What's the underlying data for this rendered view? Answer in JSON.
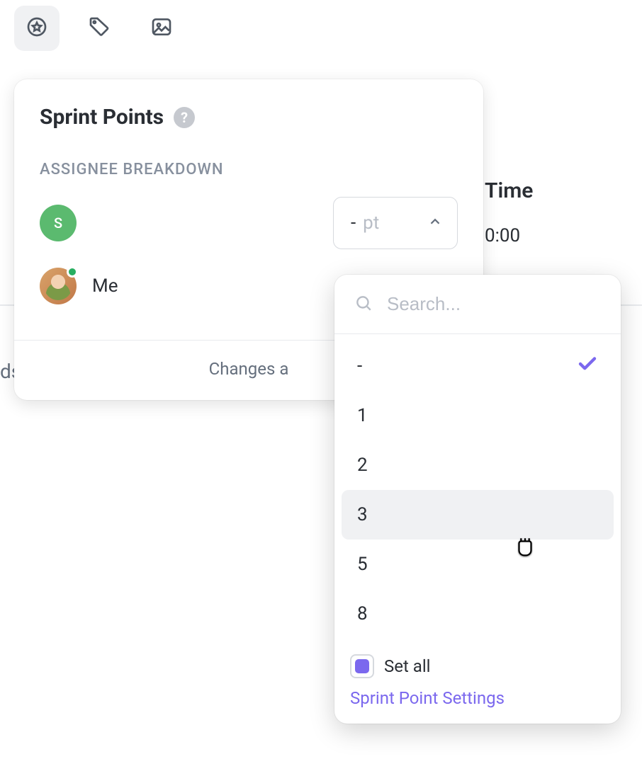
{
  "toolbar": {
    "icons": [
      "star-badge-icon",
      "tag-icon",
      "image-icon"
    ]
  },
  "background": {
    "time_label": "Time",
    "time_value": "0:00",
    "truncated_left": "ds"
  },
  "popover": {
    "title": "Sprint Points",
    "section_label": "ASSIGNEE BREAKDOWN",
    "assignees": [
      {
        "initial": "S",
        "name": "",
        "blurred": true
      },
      {
        "initial": "",
        "name": "Me",
        "photo": true,
        "presence": true
      }
    ],
    "points_select": {
      "value": "-",
      "unit": "pt"
    },
    "footer_text": "Changes a"
  },
  "dropdown": {
    "search_placeholder": "Search...",
    "options": [
      {
        "label": "-",
        "selected": true
      },
      {
        "label": "1"
      },
      {
        "label": "2"
      },
      {
        "label": "3",
        "hover": true
      },
      {
        "label": "5"
      },
      {
        "label": "8"
      }
    ],
    "set_all_label": "Set all",
    "set_all_checked": true,
    "settings_link": "Sprint Point Settings"
  }
}
